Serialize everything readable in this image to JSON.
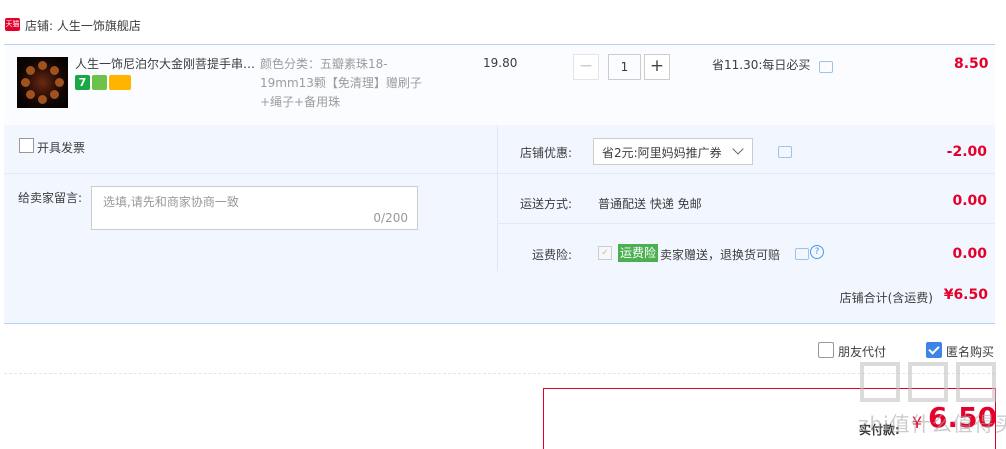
{
  "shop": {
    "badge": "天猫",
    "name": "店铺: 人生一饰旗舰店"
  },
  "item": {
    "title": "人生一饰尼泊尔大金刚菩提手串男士五瓣金刚手串",
    "service_icons": [
      "seven-day-return-icon",
      "guarantee-icon",
      "credit-card-icon"
    ],
    "service_badge_7": "7",
    "sku": "颜色分类：五瓣素珠18-19mm13颗【免清理】赠刷子+绳子+备用珠",
    "unit_price": "19.80",
    "quantity": "1",
    "promo": "省11.30:每日必买",
    "subtotal": "8.50"
  },
  "invoice": {
    "label": "开具发票",
    "checked": false
  },
  "message": {
    "label": "给卖家留言:",
    "placeholder": "选填,请先和商家协商一致",
    "counter": "0/200"
  },
  "shop_discount": {
    "label": "店铺优惠:",
    "selected": "省2元:阿里妈妈推广券",
    "amount": "-2.00"
  },
  "shipping": {
    "label": "运送方式:",
    "value": "普通配送 快递 免邮",
    "amount": "0.00"
  },
  "insurance": {
    "label": "运费险:",
    "badge": "运费险",
    "text": "卖家赠送，退换货可赔",
    "amount": "0.00",
    "help": "?"
  },
  "shop_total": {
    "label": "店铺合计(含运费)",
    "amount": "¥6.50"
  },
  "options": {
    "friend_pay": "朋友代付",
    "anonymous": "匿名购买",
    "anonymous_checked": true
  },
  "payment": {
    "label": "实付款:",
    "currency": "¥",
    "amount": "6.50"
  },
  "watermark": {
    "text": "zhi值什么值得买"
  },
  "colors": {
    "accent_red": "#e4002b",
    "border_blue": "#b2d1ff",
    "panel_bg": "#f2f7ff",
    "checkbox_blue": "#3e84e5",
    "insurance_green": "#4caf50"
  }
}
